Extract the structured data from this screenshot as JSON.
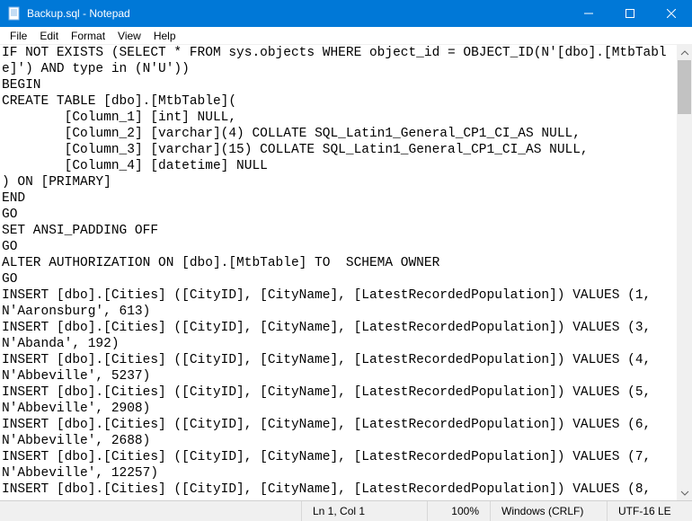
{
  "window": {
    "title": "Backup.sql - Notepad"
  },
  "menu": {
    "file": "File",
    "edit": "Edit",
    "format": "Format",
    "view": "View",
    "help": "Help"
  },
  "status": {
    "position": "Ln 1, Col 1",
    "zoom": "100%",
    "line_ending": "Windows (CRLF)",
    "encoding": "UTF-16 LE"
  },
  "editor": {
    "content": "IF NOT EXISTS (SELECT * FROM sys.objects WHERE object_id = OBJECT_ID(N'[dbo].[MtbTable]') AND type in (N'U'))\nBEGIN\nCREATE TABLE [dbo].[MtbTable](\n        [Column_1] [int] NULL,\n        [Column_2] [varchar](4) COLLATE SQL_Latin1_General_CP1_CI_AS NULL,\n        [Column_3] [varchar](15) COLLATE SQL_Latin1_General_CP1_CI_AS NULL,\n        [Column_4] [datetime] NULL\n) ON [PRIMARY]\nEND\nGO\nSET ANSI_PADDING OFF\nGO\nALTER AUTHORIZATION ON [dbo].[MtbTable] TO  SCHEMA OWNER\nGO\nINSERT [dbo].[Cities] ([CityID], [CityName], [LatestRecordedPopulation]) VALUES (1, N'Aaronsburg', 613)\nINSERT [dbo].[Cities] ([CityID], [CityName], [LatestRecordedPopulation]) VALUES (3, N'Abanda', 192)\nINSERT [dbo].[Cities] ([CityID], [CityName], [LatestRecordedPopulation]) VALUES (4, N'Abbeville', 5237)\nINSERT [dbo].[Cities] ([CityID], [CityName], [LatestRecordedPopulation]) VALUES (5, N'Abbeville', 2908)\nINSERT [dbo].[Cities] ([CityID], [CityName], [LatestRecordedPopulation]) VALUES (6, N'Abbeville', 2688)\nINSERT [dbo].[Cities] ([CityID], [CityName], [LatestRecordedPopulation]) VALUES (7, N'Abbeville', 12257)\nINSERT [dbo].[Cities] ([CityID], [CityName], [LatestRecordedPopulation]) VALUES (8,"
  }
}
